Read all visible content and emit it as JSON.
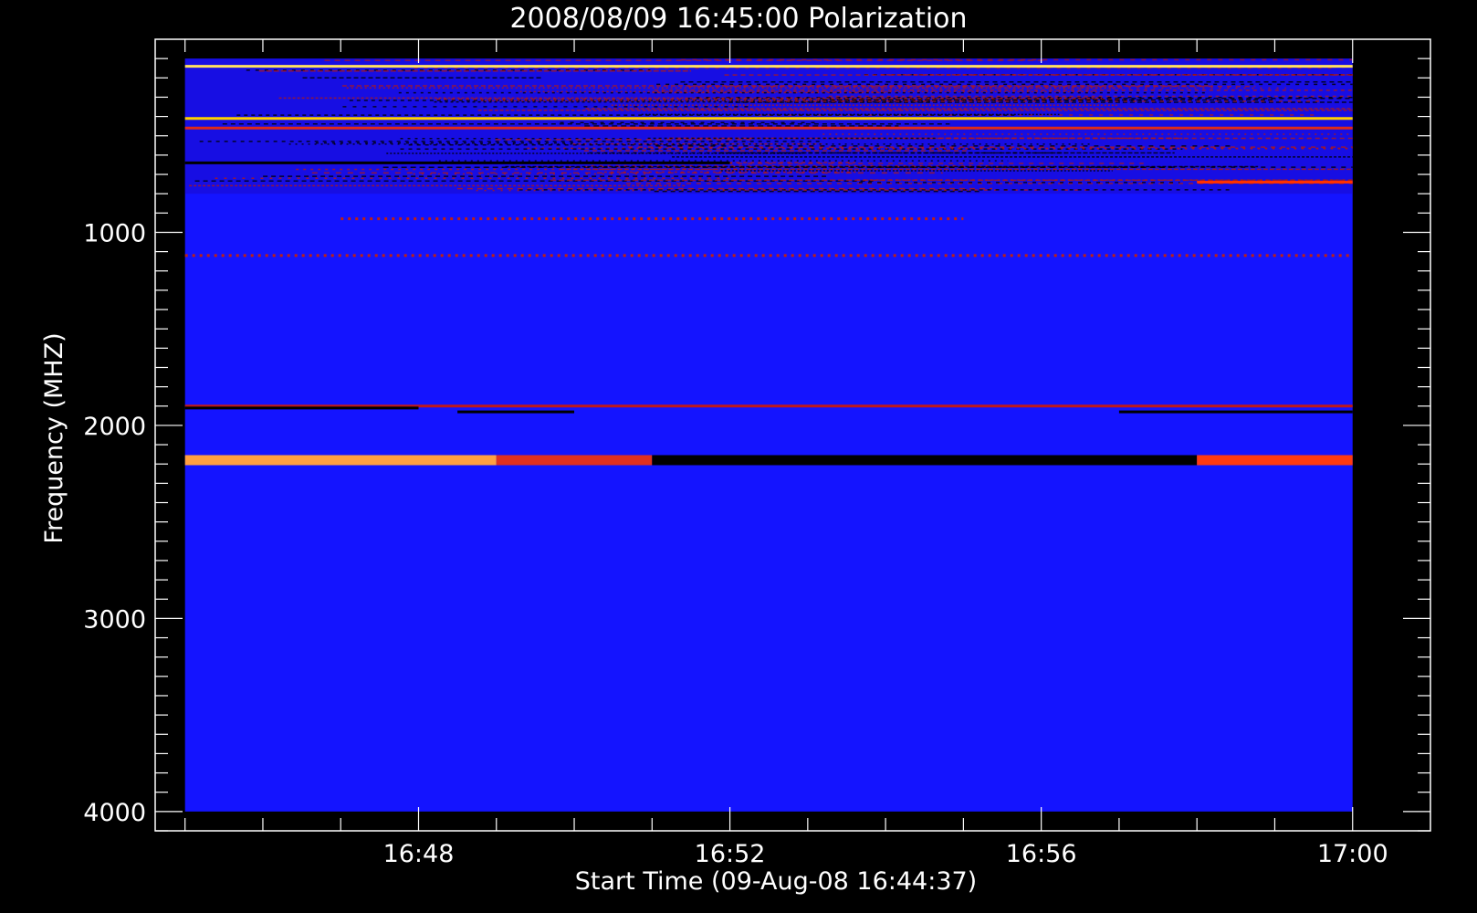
{
  "chart_data": {
    "type": "heatmap",
    "title": "2008/08/09 16:45:00 Polarization",
    "xlabel": "Start Time (09-Aug-08 16:44:37)",
    "ylabel": "Frequency (MHZ)",
    "x_tick_labels": [
      "16:48",
      "16:52",
      "16:56",
      "17:00"
    ],
    "y_tick_labels": [
      "1000",
      "2000",
      "3000",
      "4000"
    ],
    "x_ticks": [
      "16:48",
      "16:52",
      "16:56",
      "17:00"
    ],
    "y_ticks": [
      1000,
      2000,
      3000,
      4000
    ],
    "xlim": [
      "16:44:37",
      "17:01:00"
    ],
    "ylim": [
      4100,
      0
    ],
    "y_axis_inverted": true,
    "data_extent": {
      "x": [
        "16:45:00",
        "17:00:00"
      ],
      "y": [
        100,
        4000
      ]
    },
    "background_color": "#1414ff",
    "features": [
      {
        "kind": "noisy_band",
        "y_range": [
          100,
          800
        ],
        "description_colors": [
          "#1a0acc",
          "#b01818",
          "#000000"
        ]
      },
      {
        "kind": "line",
        "y": 140,
        "color": "#ffe060",
        "x_range": [
          "16:45:00",
          "17:00:00"
        ]
      },
      {
        "kind": "line",
        "y": 410,
        "color": "#ffd000",
        "x_range": [
          "16:45:00",
          "17:00:00"
        ]
      },
      {
        "kind": "line",
        "y": 460,
        "color": "#e02a1a",
        "x_range": [
          "16:45:00",
          "17:00:00"
        ]
      },
      {
        "kind": "line",
        "y": 640,
        "color": "#000000",
        "x_range": [
          "16:45:00",
          "16:52:00"
        ]
      },
      {
        "kind": "line",
        "y": 740,
        "color": "#ff3000",
        "x_range": [
          "16:58:00",
          "17:00:00"
        ]
      },
      {
        "kind": "dashed_line",
        "y": 930,
        "color": "#c02010",
        "x_range": [
          "16:47:00",
          "16:55:00"
        ]
      },
      {
        "kind": "dashed_line",
        "y": 1120,
        "color": "#c02010",
        "x_range": [
          "16:45:00",
          "17:00:00"
        ]
      },
      {
        "kind": "line",
        "y": 1900,
        "color": "#c01818",
        "x_range": [
          "16:45:00",
          "17:00:00"
        ]
      },
      {
        "kind": "line",
        "y": 1910,
        "color": "#000000",
        "x_range": [
          "16:45:00",
          "16:48:00"
        ]
      },
      {
        "kind": "line",
        "y": 1930,
        "color": "#000000",
        "x_range": [
          "16:48:30",
          "16:50:00"
        ]
      },
      {
        "kind": "line",
        "y": 1930,
        "color": "#000000",
        "x_range": [
          "16:57:00",
          "17:00:00"
        ]
      },
      {
        "kind": "line",
        "y": 2180,
        "color": "#ffa040",
        "x_range": [
          "16:45:00",
          "16:49:00"
        ]
      },
      {
        "kind": "line",
        "y": 2180,
        "color": "#e03020",
        "x_range": [
          "16:49:00",
          "16:51:00"
        ]
      },
      {
        "kind": "line",
        "y": 2180,
        "color": "#000000",
        "x_range": [
          "16:51:00",
          "16:58:00"
        ]
      },
      {
        "kind": "line",
        "y": 2180,
        "color": "#ff3a10",
        "x_range": [
          "16:58:00",
          "17:00:00"
        ]
      }
    ]
  }
}
